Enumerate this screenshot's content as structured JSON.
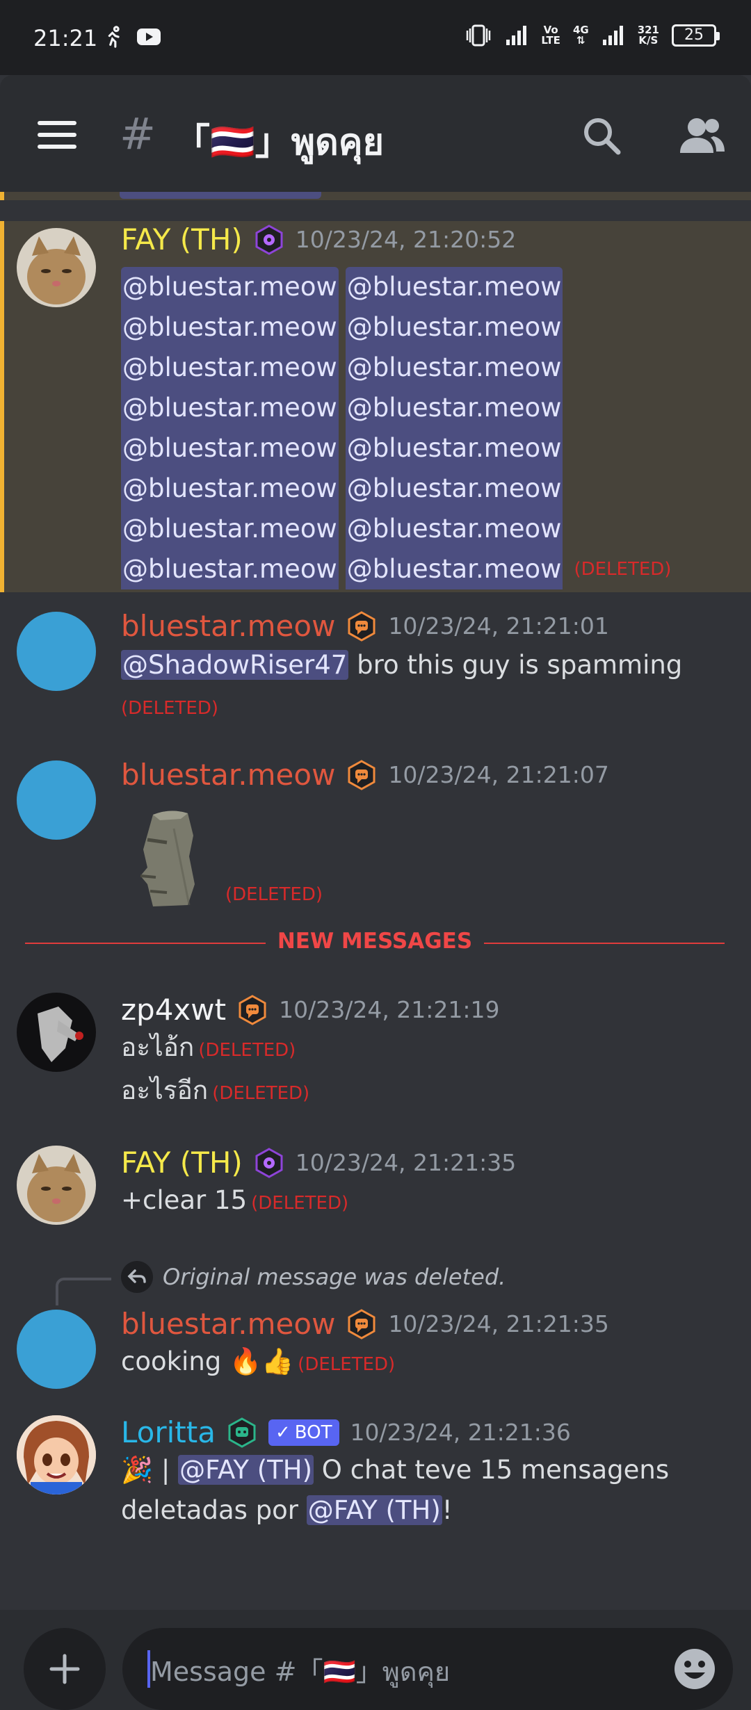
{
  "status_bar": {
    "time": "21:21",
    "network_label_top": "Vo",
    "network_label_bottom": "LTE",
    "network_type": "4G",
    "speed_value": "321",
    "speed_unit": "K/S",
    "battery": "25"
  },
  "header": {
    "hash": "#",
    "channel_title": "「🇹🇭」พูดคุย"
  },
  "messages": [
    {
      "author": "FAY (TH)",
      "timestamp": "10/23/24, 21:20:52",
      "mention": "@bluestar.meow",
      "deleted_label": "(DELETED)"
    },
    {
      "author": "bluestar.meow",
      "timestamp": "10/23/24, 21:21:01",
      "mention": "@ShadowRiser47",
      "text": " bro this guy is spamming",
      "deleted_label": "(DELETED)"
    },
    {
      "author": "bluestar.meow",
      "timestamp": "10/23/24, 21:21:07",
      "sticker": "moai-icon",
      "deleted_label": "(DELETED)"
    },
    {
      "author": "zp4xwt",
      "timestamp": "10/23/24, 21:21:19",
      "line1": "อะไอ้ก",
      "line2": "อะไรอีก",
      "deleted_label": "(DELETED)"
    },
    {
      "author": "FAY (TH)",
      "timestamp": "10/23/24, 21:21:35",
      "text": "+clear 15",
      "deleted_label": "(DELETED)"
    },
    {
      "reply_text": "Original message was deleted.",
      "author": "bluestar.meow",
      "timestamp": "10/23/24, 21:21:35",
      "text": "cooking 🔥👍",
      "deleted_label": "(DELETED)"
    },
    {
      "author": "Loritta",
      "bot_tag": "BOT",
      "timestamp": "10/23/24, 21:21:36",
      "prefix": "🎉 | ",
      "mention": "@FAY (TH)",
      "text_mid": " O chat teve 15 mensagens",
      "text_line2": "deletadas por ",
      "text_end": "!"
    }
  ],
  "new_messages_label": "NEW MESSAGES",
  "composer": {
    "placeholder": "Message #「🇹🇭」พูดคุย"
  },
  "colors": {
    "background": "#313338",
    "header": "#2b2d31",
    "highlight": "#47433a",
    "highlight_bar": "#f0b232",
    "mention_bg": "#4c4e80",
    "deleted": "#d82a2a",
    "new_messages": "#f04747",
    "bot_tag": "#5865f2"
  }
}
